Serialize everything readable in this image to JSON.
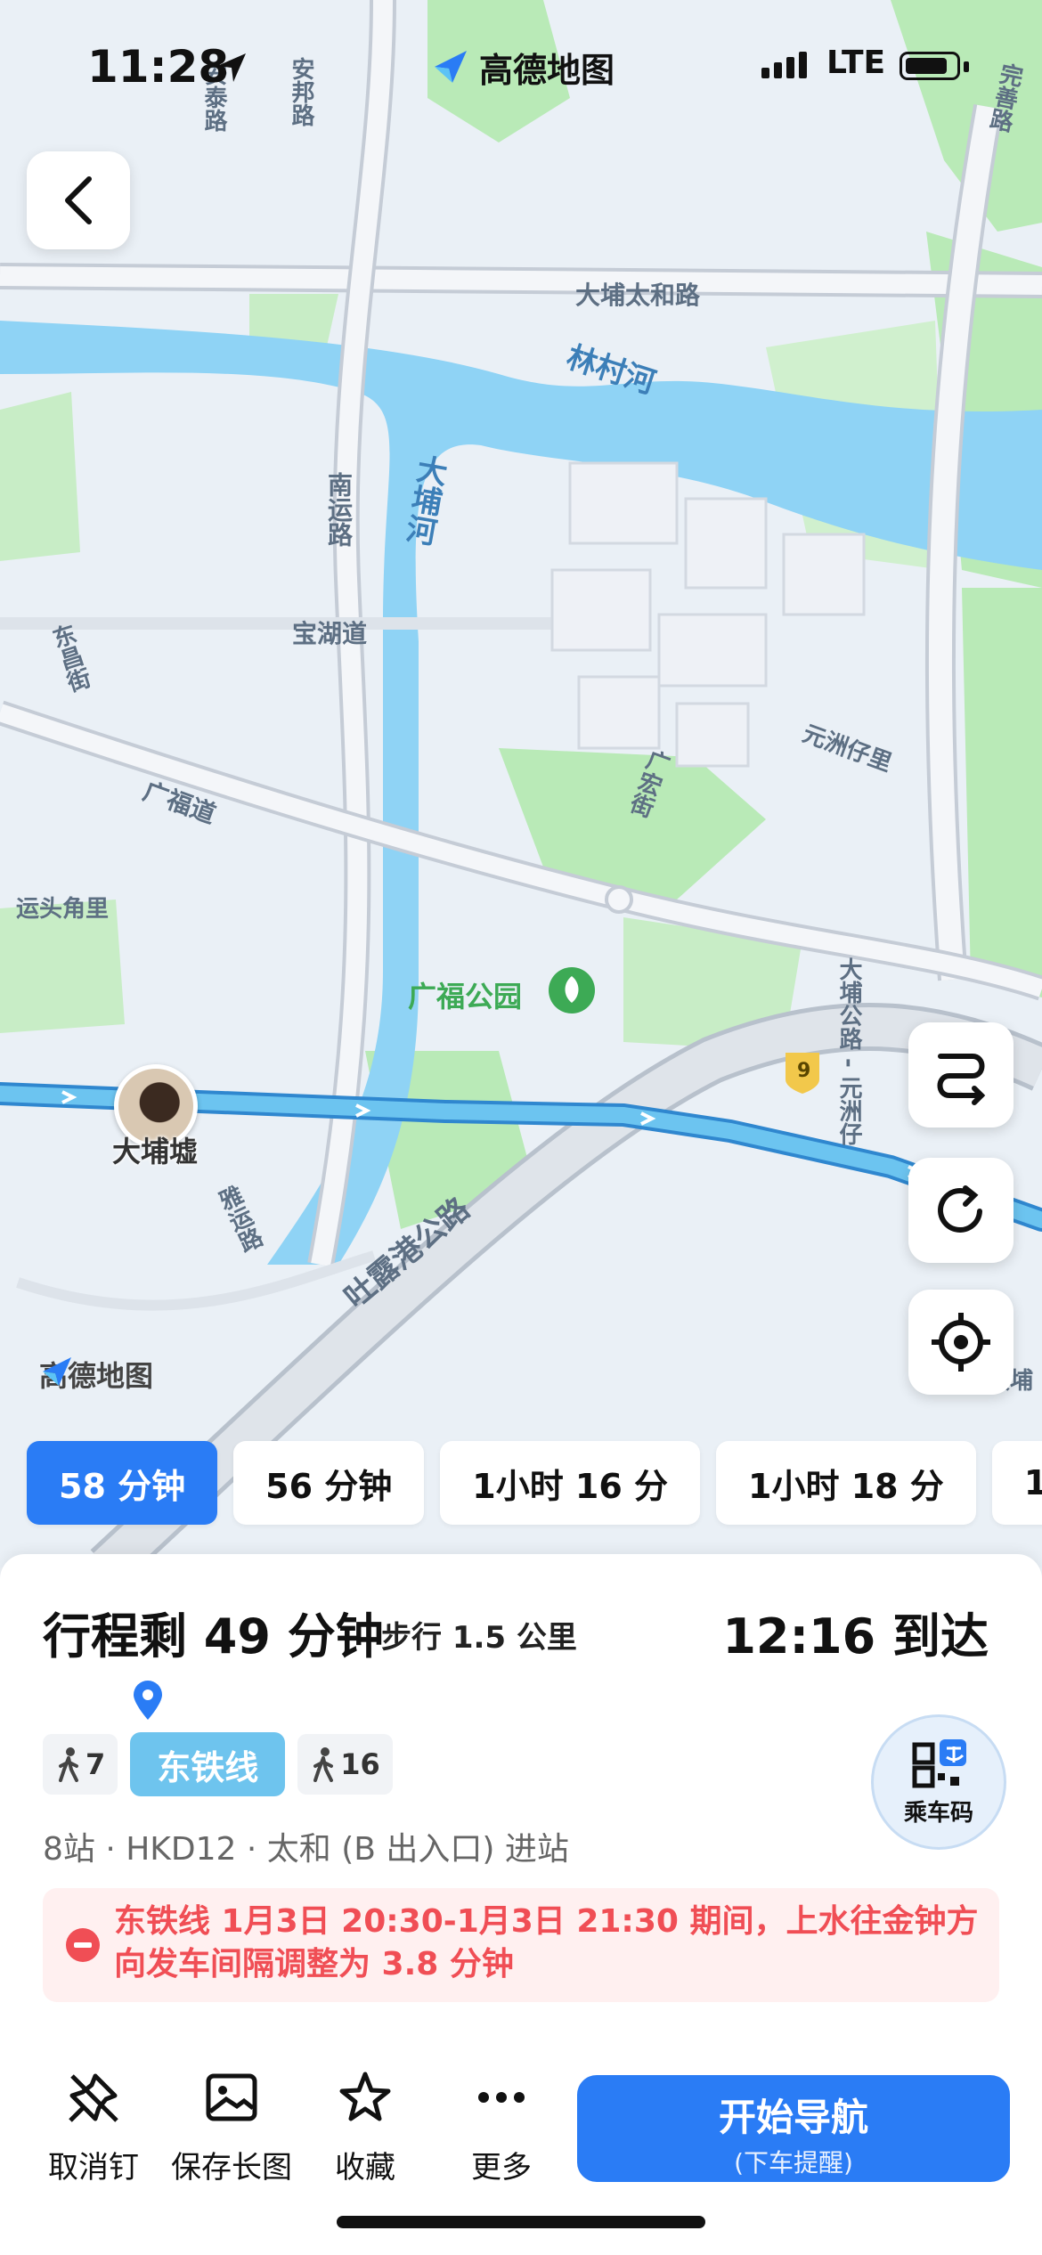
{
  "status_bar": {
    "time": "11:28",
    "network": "LTE"
  },
  "brand": "高德地图",
  "map": {
    "roads": [
      "安泰路",
      "安邦路",
      "完善路",
      "大埔太和路",
      "南运路",
      "宝湖道",
      "东昌街",
      "广福道",
      "运头角里",
      "元洲仔里",
      "广宏街",
      "大埔公路 - 元洲仔",
      "吐露港公路",
      "雅运路",
      "大埔"
    ],
    "rivers": [
      "林村河",
      "大埔河"
    ],
    "park": "广福公园",
    "route_badge": "9",
    "user_label": "大埔墟",
    "watermark": "高德地图"
  },
  "route_options": [
    "58 分钟",
    "56 分钟",
    "1小时 16 分",
    "1小时 18 分",
    "1"
  ],
  "trip": {
    "title": "行程剩 49 分钟",
    "walk": "步行 1.5 公里",
    "arrive": "12:16 到达",
    "walk_before": "7",
    "line": "东铁线",
    "walk_after": "16",
    "qr_label": "乘车码",
    "station_info": "8站 · HKD12 · 太和 (B 出入口) 进站",
    "alert": "东铁线 1月3日 20:30-1月3日 21:30 期间，上水往金钟方向发车间隔调整为 3.8 分钟"
  },
  "toolbar": {
    "unpin": "取消钉",
    "save_image": "保存长图",
    "favorite": "收藏",
    "more": "更多",
    "nav_main": "开始导航",
    "nav_sub": "(下车提醒)"
  },
  "colors": {
    "accent": "#2a7cf5",
    "water": "#8fd3f5",
    "green": "#b9eab7",
    "route": "#57b5e8",
    "alert": "#f04e55"
  }
}
